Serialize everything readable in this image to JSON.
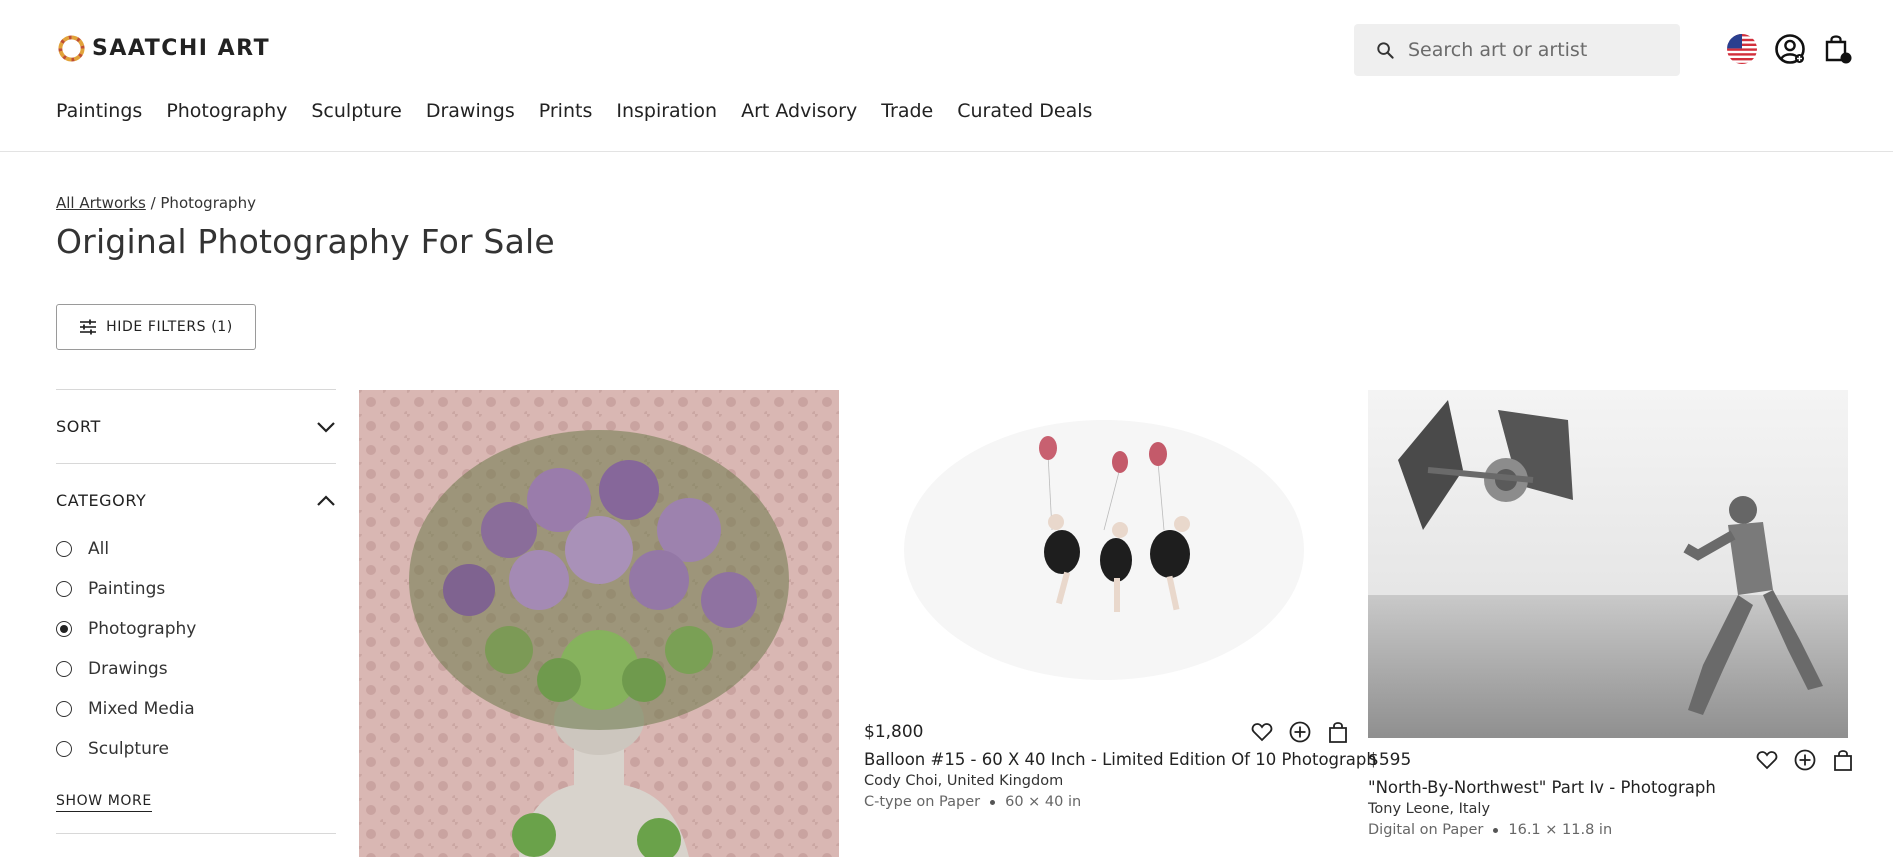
{
  "brand": {
    "name": "SAATCHI ART"
  },
  "search": {
    "placeholder": "Search art or artist"
  },
  "header_icons": [
    "us-flag-icon",
    "account-icon",
    "cart-icon"
  ],
  "cart": {
    "count": "0"
  },
  "nav": [
    "Paintings",
    "Photography",
    "Sculpture",
    "Drawings",
    "Prints",
    "Inspiration",
    "Art Advisory",
    "Trade",
    "Curated Deals"
  ],
  "breadcrumb": {
    "root": "All Artworks",
    "separator": " / ",
    "current": "Photography"
  },
  "page": {
    "title": "Original Photography For Sale"
  },
  "filters_button": {
    "label": "HIDE FILTERS (1)"
  },
  "sidebar": {
    "sort_label": "SORT",
    "category_label": "CATEGORY",
    "categories": [
      {
        "label": "All",
        "selected": false
      },
      {
        "label": "Paintings",
        "selected": false
      },
      {
        "label": "Photography",
        "selected": true
      },
      {
        "label": "Drawings",
        "selected": false
      },
      {
        "label": "Mixed Media",
        "selected": false
      },
      {
        "label": "Sculpture",
        "selected": false
      }
    ],
    "show_more": "SHOW MORE"
  },
  "artworks": [
    {
      "price": "$1,800",
      "title": "Balloon #15 - 60 X 40 Inch - Limited Edition Of 10 Photograph",
      "artist": "Cody Choi, United Kingdom",
      "medium": "C-type on Paper",
      "size": "60 × 40 in"
    },
    {
      "price": "$595",
      "title": "\"North-By-Northwest\" Part Iv - Photograph",
      "artist": "Tony Leone, Italy",
      "medium": "Digital on Paper",
      "size": "16.1 × 11.8 in"
    }
  ],
  "colors": {
    "text": "#222222",
    "divider": "#d8d8d8",
    "search_bg": "#efefef"
  }
}
